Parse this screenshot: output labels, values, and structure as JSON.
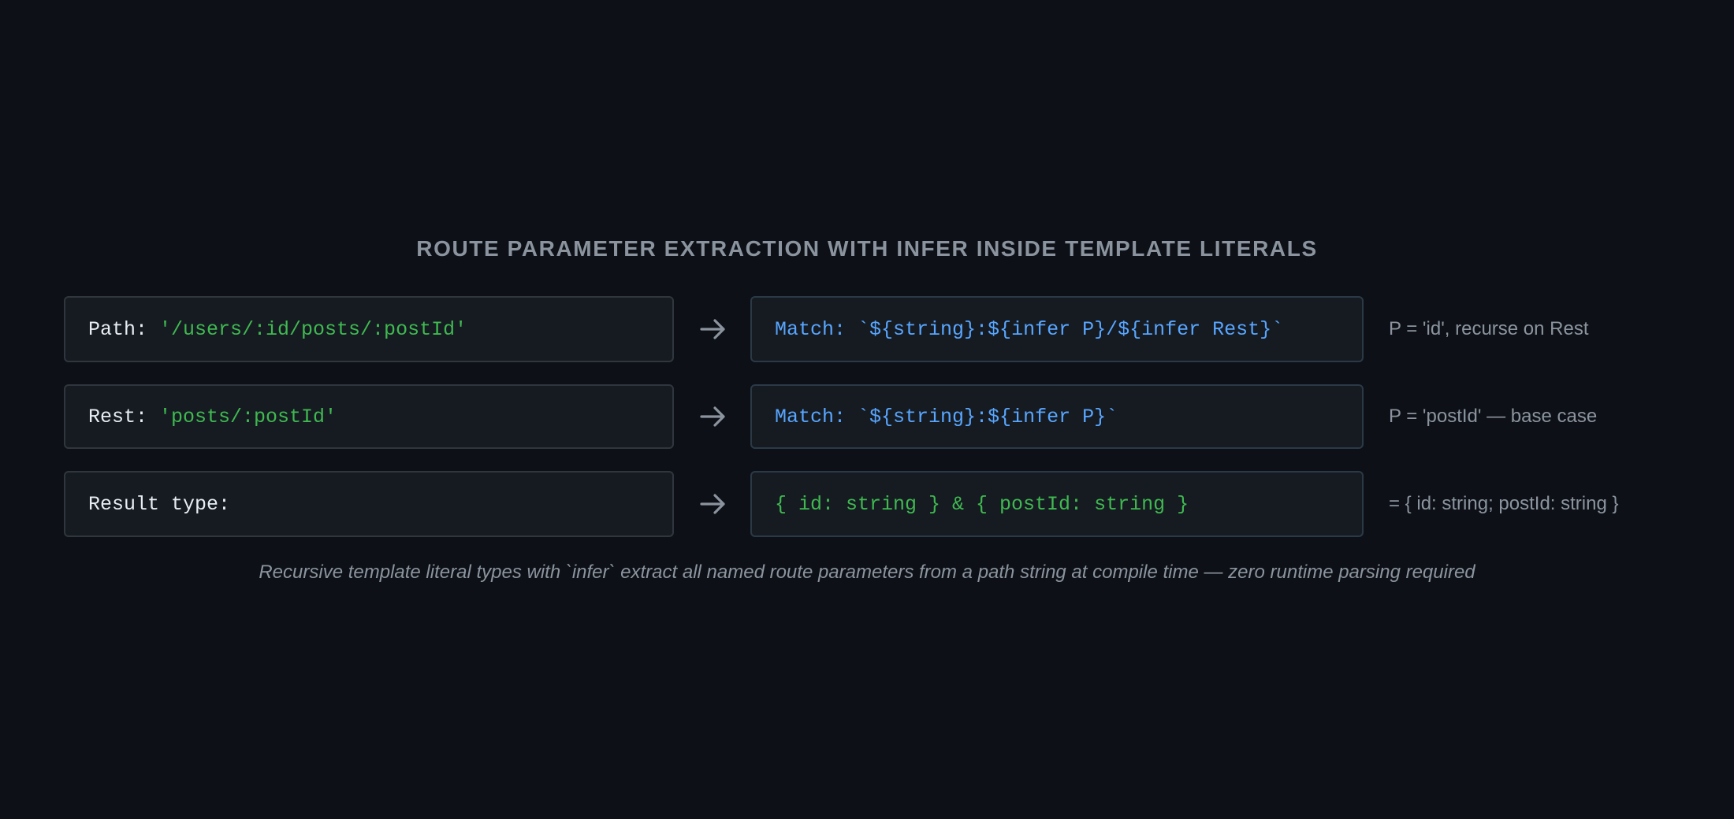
{
  "title": "ROUTE PARAMETER EXTRACTION WITH INFER INSIDE TEMPLATE LITERALS",
  "rows": [
    {
      "input_label": "Path: ",
      "input_value": "'/users/:id/posts/:postId'",
      "match_label": "Match: ",
      "match_value": "`${string}:${infer P}/${infer Rest}`",
      "note": "P = 'id', recurse on Rest"
    },
    {
      "input_label": "Rest: ",
      "input_value": "'posts/:postId'",
      "match_label": "Match: ",
      "match_value": "`${string}:${infer P}`",
      "note": "P = 'postId' — base case"
    },
    {
      "input_label": "Result type:",
      "input_value": "",
      "match_label": "",
      "match_value": "{ id: string } & { postId: string }",
      "note": "= { id: string; postId: string }"
    }
  ],
  "caption": "Recursive template literal types with `infer` extract all named route parameters from a path string at compile time — zero runtime parsing required",
  "colors": {
    "background": "#0d1117",
    "box_fill": "#161b22",
    "string_literal": "#3fb950",
    "template_pattern": "#58a6ff",
    "muted_text": "#8b949e",
    "code_label": "#e6edf3"
  },
  "icons": {
    "arrow": "arrow-right-icon"
  }
}
